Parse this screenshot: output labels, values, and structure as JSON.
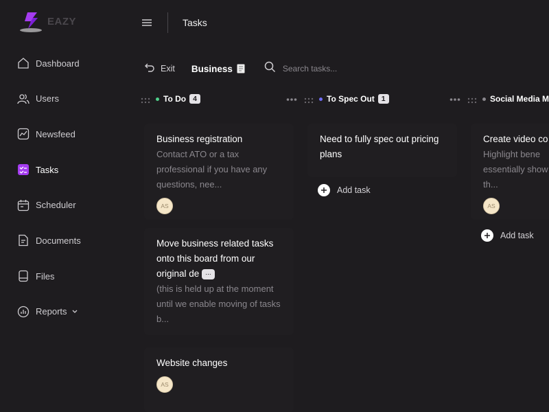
{
  "app": {
    "name": "EAZY",
    "accent": "#a53cf0"
  },
  "sidebar": {
    "items": [
      {
        "label": "Dashboard",
        "icon": "home-icon"
      },
      {
        "label": "Users",
        "icon": "users-icon"
      },
      {
        "label": "Newsfeed",
        "icon": "trend-icon"
      },
      {
        "label": "Tasks",
        "icon": "tasks-icon",
        "active": true
      },
      {
        "label": "Scheduler",
        "icon": "calendar-icon"
      },
      {
        "label": "Documents",
        "icon": "document-icon"
      },
      {
        "label": "Files",
        "icon": "file-icon"
      },
      {
        "label": "Reports",
        "icon": "chart-icon"
      }
    ]
  },
  "header": {
    "title": "Tasks"
  },
  "toolbar": {
    "exit_label": "Exit",
    "board_name": "Business",
    "search_placeholder": "Search tasks..."
  },
  "columns": [
    {
      "title": "To Do",
      "count": "4",
      "dot_color": "#4fd18b",
      "cards": [
        {
          "title": "Business registration",
          "desc": "Contact ATO or a tax professional if you have any questions, nee...",
          "avatar": "AS"
        },
        {
          "title": "Move business related tasks onto this board from our original de",
          "chip": "...",
          "desc": "(this is held up at the moment until we enable moving of tasks b..."
        },
        {
          "title": "Website changes",
          "avatar": "AS"
        }
      ]
    },
    {
      "title": "To Spec Out",
      "count": "1",
      "dot_color": "#6f6cf6",
      "cards": [
        {
          "title": "Need to fully spec out pricing plans"
        }
      ],
      "add_label": "Add task"
    },
    {
      "title": "Social Media M",
      "dot_color": "#8a878d",
      "cards": [
        {
          "title": "Create video co",
          "desc": "Highlight bene essentially show th...",
          "desc_line1": "Highlight bene",
          "desc_line2": "essentially show",
          "desc_line3": "th...",
          "avatar": "AS"
        }
      ],
      "add_label": "Add task"
    }
  ]
}
